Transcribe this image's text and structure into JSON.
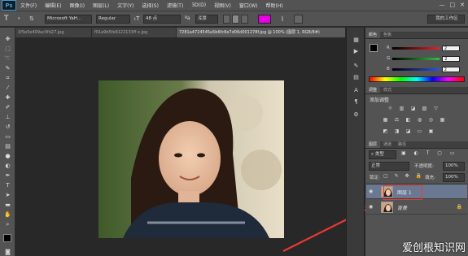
{
  "app": {
    "logo": "Ps",
    "menu": [
      "文件(F)",
      "编辑(E)",
      "图像(I)",
      "图层(L)",
      "文字(Y)",
      "选择(S)",
      "滤镜(T)",
      "3D(D)",
      "视图(V)",
      "窗口(W)",
      "帮助(H)"
    ],
    "window_controls": [
      "—",
      "□",
      "✕"
    ]
  },
  "options": {
    "tool_glyph": "T",
    "font_family": "Microsoft YaH...",
    "font_style": "Regular",
    "font_size": "48 点",
    "antialias": "浑厚",
    "color_swatch": "#e600e6",
    "workspace": "我的工作区"
  },
  "tabs": [
    {
      "label": "1f5e5e409ac0fd27.jpg"
    },
    {
      "label": "f01a9b5fe9122133ff e.jpg"
    },
    {
      "label": "7281a4724545a5b6fc8e7d06d001278f.jpg @ 100% (图层 1, RGB/8#)",
      "active": true
    }
  ],
  "color_panel": {
    "tabs": [
      "颜色",
      "色板"
    ],
    "channels": [
      {
        "label": "R",
        "value": "2",
        "track": "#e0242e"
      },
      {
        "label": "G",
        "value": "2",
        "track": "#2ec43c"
      },
      {
        "label": "B",
        "value": "2",
        "track": "#2c54e6"
      }
    ]
  },
  "adjust_panel": {
    "tabs": [
      "调整",
      "样式"
    ],
    "title": "添加调整"
  },
  "layers_panel": {
    "tabs": [
      "图层",
      "通道",
      "路径"
    ],
    "filter": "类型",
    "blend_mode": "正常",
    "opacity_label": "不透明度:",
    "opacity_value": "100%",
    "lock_label": "锁定:",
    "fill_label": "填充:",
    "fill_value": "100%",
    "layers": [
      {
        "name": "图层 1",
        "selected": true
      },
      {
        "name": "背景",
        "locked": true
      }
    ]
  },
  "annotation_color": "#e53935",
  "watermark": "爱创根知识网"
}
